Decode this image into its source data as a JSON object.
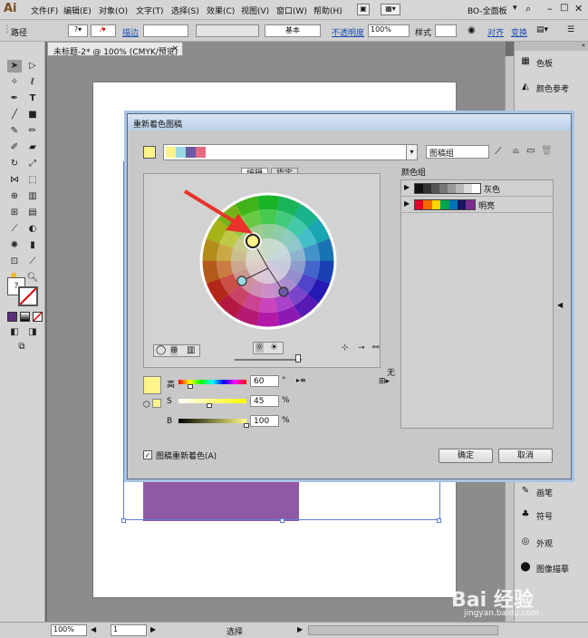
{
  "menubar": {
    "logo": "Ai",
    "items": [
      "文件(F)",
      "编辑(E)",
      "对象(O)",
      "文字(T)",
      "选择(S)",
      "效果(C)",
      "视图(V)",
      "窗口(W)",
      "帮助(H)"
    ],
    "workspace": "BO-全面板"
  },
  "controlbar": {
    "selection": "路径",
    "stroke_label": "描边",
    "stroke_preset": "基本",
    "opacity_label": "不透明度",
    "opacity_value": "100%",
    "style_label": "样式",
    "align_label": "对齐",
    "transform_label": "变换"
  },
  "document": {
    "tab_title": "未标题-2* @ 100% (CMYK/预览)"
  },
  "right_panel": {
    "items": [
      "色板",
      "颜色参考",
      "画笔",
      "符号",
      "外观",
      "图像描摹"
    ]
  },
  "statusbar": {
    "zoom": "100%",
    "artboard": "1",
    "tool": "选择"
  },
  "dialog": {
    "title": "重新着色图稿",
    "harmony_field": "图稿组",
    "tabs": [
      "编辑",
      "指定"
    ],
    "groups_label": "颜色组",
    "groups": [
      {
        "name": "灰色"
      },
      {
        "name": "明亮"
      }
    ],
    "h_label": "高",
    "h_value": "60",
    "h_unit": "°",
    "s_label": "S",
    "s_value": "45",
    "s_unit": "%",
    "b_label": "B",
    "b_value": "100",
    "b_unit": "%",
    "none_label": "无",
    "recolor_checkbox": "图稿重新着色(A)",
    "ok": "确定",
    "cancel": "取消"
  },
  "colors": {
    "accent_yellow": "#fff38a",
    "rect_purple": "#8f5aa3",
    "arrow_red": "#e8322a"
  },
  "watermark": {
    "brand": "Bai 经验",
    "url": "jingyan.baidu.com"
  }
}
